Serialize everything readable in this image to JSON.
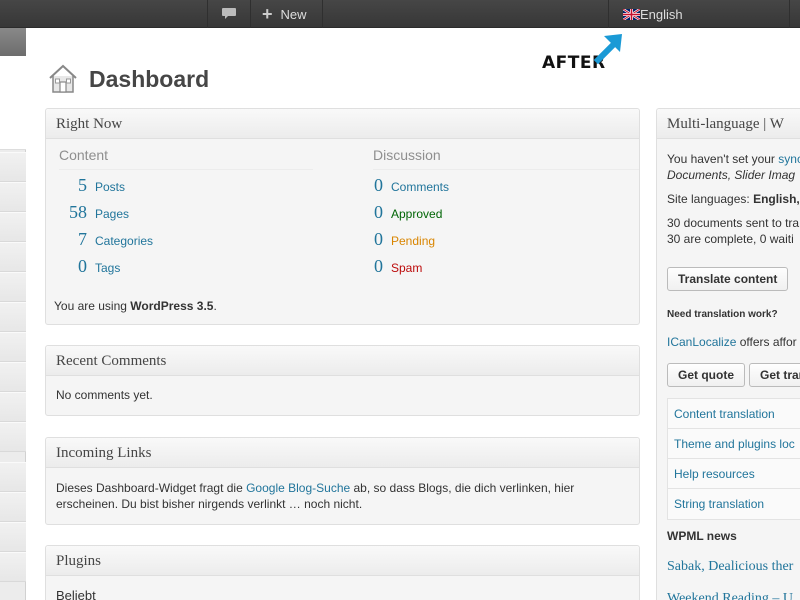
{
  "adminbar": {
    "new_label": "New",
    "language_label": "English"
  },
  "annotation": {
    "after_label": "AFTER",
    "arrow_color": "#1a9ad6"
  },
  "page": {
    "title": "Dashboard"
  },
  "right_now": {
    "title": "Right Now",
    "content_heading": "Content",
    "discussion_heading": "Discussion",
    "content_items": [
      {
        "count": "5",
        "label": "Posts"
      },
      {
        "count": "58",
        "label": "Pages"
      },
      {
        "count": "7",
        "label": "Categories"
      },
      {
        "count": "0",
        "label": "Tags"
      }
    ],
    "discussion_items": [
      {
        "count": "0",
        "label": "Comments",
        "color": "#21759b"
      },
      {
        "count": "0",
        "label": "Approved",
        "color": "#006505"
      },
      {
        "count": "0",
        "label": "Pending",
        "color": "#d98500"
      },
      {
        "count": "0",
        "label": "Spam",
        "color": "#bc0b0b"
      }
    ],
    "version_prefix": "You are using ",
    "version_name": "WordPress 3.5",
    "version_suffix": "."
  },
  "recent_comments": {
    "title": "Recent Comments",
    "body": "No comments yet."
  },
  "incoming_links": {
    "title": "Incoming Links",
    "text_before": "Dieses Dashboard-Widget fragt die ",
    "link": "Google Blog-Suche",
    "text_after_1": " ab, so dass Blogs, die dich verlinken, hier",
    "text_after_2": "erscheinen. Du bist bisher nirgends verlinkt … noch nicht."
  },
  "plugins": {
    "title": "Plugins",
    "first_item": "Beliebt"
  },
  "multilang": {
    "title": "Multi-language | W",
    "sync_prefix": "You haven't set your ",
    "sync_link": "sync",
    "sync_line2": "Documents, Slider Imag",
    "site_languages_prefix": "Site languages: ",
    "site_languages_value": "English,",
    "docs_line1": "30 documents sent to tra",
    "docs_line2": "30 are complete, 0 waiti",
    "translate_button": "Translate content",
    "need_translation": "Need translation work?",
    "icl_link": "ICanLocalize",
    "icl_text": " offers affor",
    "quote_button": "Get quote",
    "get_tran_button": "Get tran",
    "links": [
      "Content translation",
      "Theme and plugins loc",
      "Help resources",
      "String translation"
    ],
    "news_heading": "WPML news",
    "news_1": "Sabak, Dealicious ther",
    "news_2": "Weekend Reading – U"
  }
}
